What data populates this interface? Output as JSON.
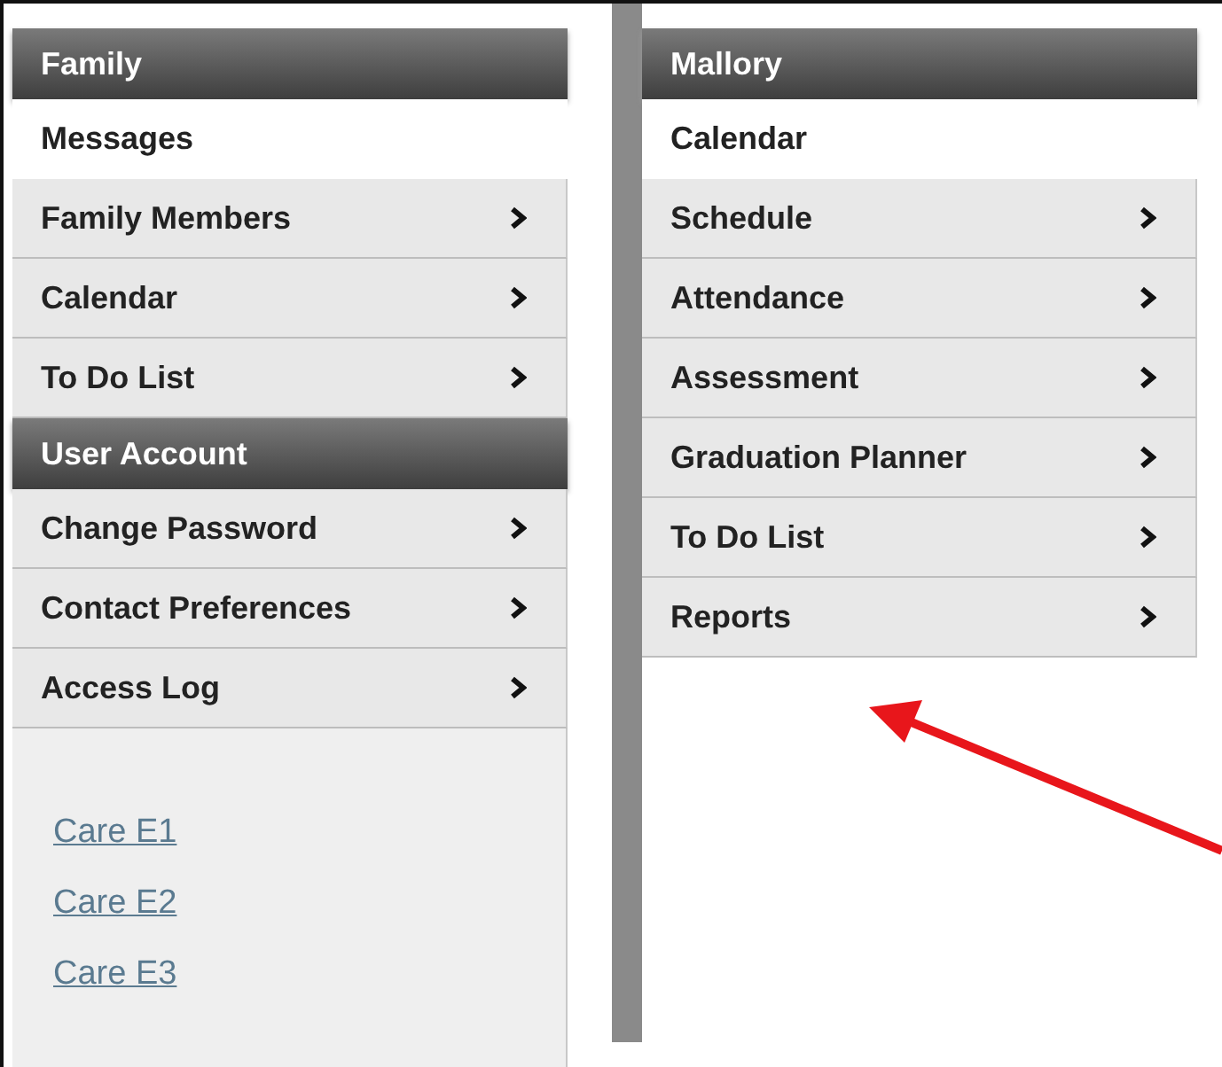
{
  "left_menu": [
    {
      "kind": "header",
      "label": "Family"
    },
    {
      "kind": "plain",
      "label": "Messages"
    },
    {
      "kind": "link",
      "label": "Family Members"
    },
    {
      "kind": "link",
      "label": "Calendar"
    },
    {
      "kind": "link",
      "label": "To Do List"
    },
    {
      "kind": "header",
      "label": "User Account"
    },
    {
      "kind": "link",
      "label": "Change Password"
    },
    {
      "kind": "link",
      "label": "Contact Preferences"
    },
    {
      "kind": "link",
      "label": "Access Log"
    }
  ],
  "left_links": [
    "Care E1",
    "Care E2",
    "Care E3"
  ],
  "right_menu": [
    {
      "kind": "header",
      "label": "Mallory"
    },
    {
      "kind": "plain",
      "label": "Calendar"
    },
    {
      "kind": "link",
      "label": "Schedule"
    },
    {
      "kind": "link",
      "label": "Attendance"
    },
    {
      "kind": "link",
      "label": "Assessment"
    },
    {
      "kind": "link",
      "label": "Graduation Planner"
    },
    {
      "kind": "link",
      "label": "To Do List"
    },
    {
      "kind": "link",
      "label": "Reports"
    }
  ]
}
